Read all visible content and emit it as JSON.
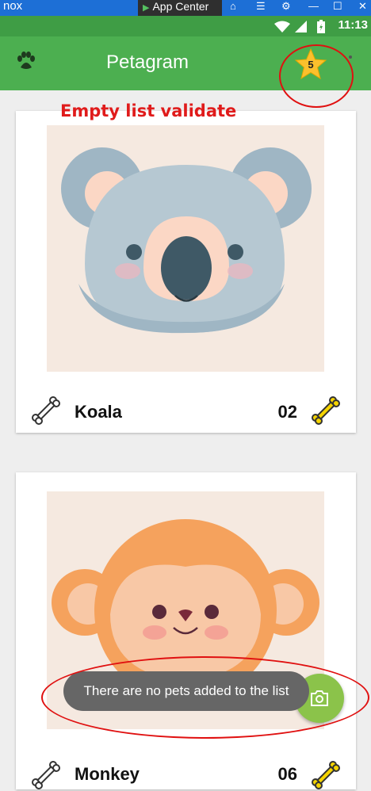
{
  "emulator": {
    "logo": "nox",
    "app_center": "App Center",
    "icons": [
      "home-icon",
      "menu-icon",
      "settings-icon",
      "minimize-icon",
      "maximize-icon",
      "close-icon"
    ]
  },
  "status_bar": {
    "time": "11:13",
    "icons": [
      "wifi-icon",
      "signal-icon",
      "battery-icon"
    ]
  },
  "app_bar": {
    "title": "Petagram",
    "favorites_count": "5",
    "colors": {
      "primary": "#4caf50",
      "status": "#3f9d45",
      "star": "#fbc02d"
    }
  },
  "annotation": {
    "label": "Empty list validate",
    "color": "#e01b1b"
  },
  "pets": [
    {
      "name": "Koala",
      "rating": "02",
      "image": "koala-illustration"
    },
    {
      "name": "Monkey",
      "rating": "06",
      "image": "monkey-illustration"
    }
  ],
  "toast": {
    "message": "There are no pets added to the list"
  },
  "fab": {
    "icon": "camera-icon",
    "color": "#8bc34a"
  }
}
